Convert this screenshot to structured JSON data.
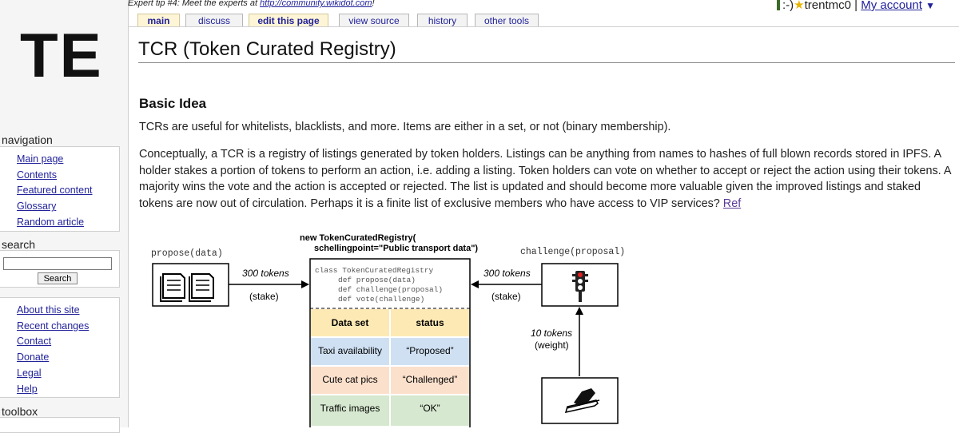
{
  "logo": "TE",
  "topbar": {
    "expert_tip_prefix": "Expert tip #4: Meet the experts at ",
    "expert_tip_link": "http://community.wikidot.com",
    "expert_tip_suffix": "!",
    "user_prefix": ":-)",
    "star": "★",
    "username": "trentmc0",
    "separator": "|",
    "account": "My account",
    "dropdown": "▼"
  },
  "tabs": [
    "main",
    "discuss",
    "edit this page",
    "view source",
    "history",
    "other tools"
  ],
  "sidebar": {
    "navigation_heading": "navigation",
    "navigation": [
      "Main page",
      "Contents",
      "Featured content",
      "Glossary",
      "Random article"
    ],
    "search_heading": "search",
    "search_button": "Search",
    "site_links": [
      "About this site",
      "Recent changes",
      "Contact",
      "Donate",
      "Legal",
      "Help"
    ],
    "toolbox_heading": "toolbox"
  },
  "page": {
    "title": "TCR (Token Curated Registry)",
    "section_heading": "Basic Idea",
    "para1": "TCRs are useful for whitelists, blacklists, and more. Items are either in a set, or not (binary membership).",
    "para2": "Conceptually, a TCR is a registry of listings generated by token holders. Listings can be anything from names to hashes of full blown records stored in IPFS. A holder stakes a portion of tokens to perform an action, i.e. adding a listing. Token holders can vote on whether to accept or reject the action using their tokens. A majority wins the vote and the action is accepted or rejected. The list is updated and should become more valuable given the improved listings and staked tokens are now out of circulation. Perhaps it is a finite list of exclusive members who have access to VIP services? ",
    "para2_ref": "Ref"
  },
  "diagram": {
    "registry_title_line1": "new TokenCuratedRegistry(",
    "registry_title_line2": "schellingpoint=\"Public transport data\")",
    "propose_label": "propose(data)",
    "challenge_label": "challenge(proposal)",
    "left_tokens": "300 tokens",
    "left_stake": "(stake)",
    "right_tokens": "300 tokens",
    "right_stake": "(stake)",
    "vote_tokens": "10 tokens",
    "vote_weight": "(weight)",
    "code": [
      "class TokenCuratedRegistry",
      "def propose(data)",
      "def challenge(proposal)",
      "def vote(challenge)"
    ],
    "table_headers": [
      "Data set",
      "status"
    ],
    "rows": [
      {
        "name": "Taxi availability",
        "status": "“Proposed”"
      },
      {
        "name": "Cute cat pics",
        "status": "“Challenged”"
      },
      {
        "name": "Traffic images",
        "status": "“OK”"
      }
    ],
    "colors": {
      "header": "#fde9b4",
      "proposed": "#cfe0f3",
      "challenged": "#fbe0cc",
      "ok": "#d6e8cf",
      "traffic_red": "#e02020"
    }
  }
}
